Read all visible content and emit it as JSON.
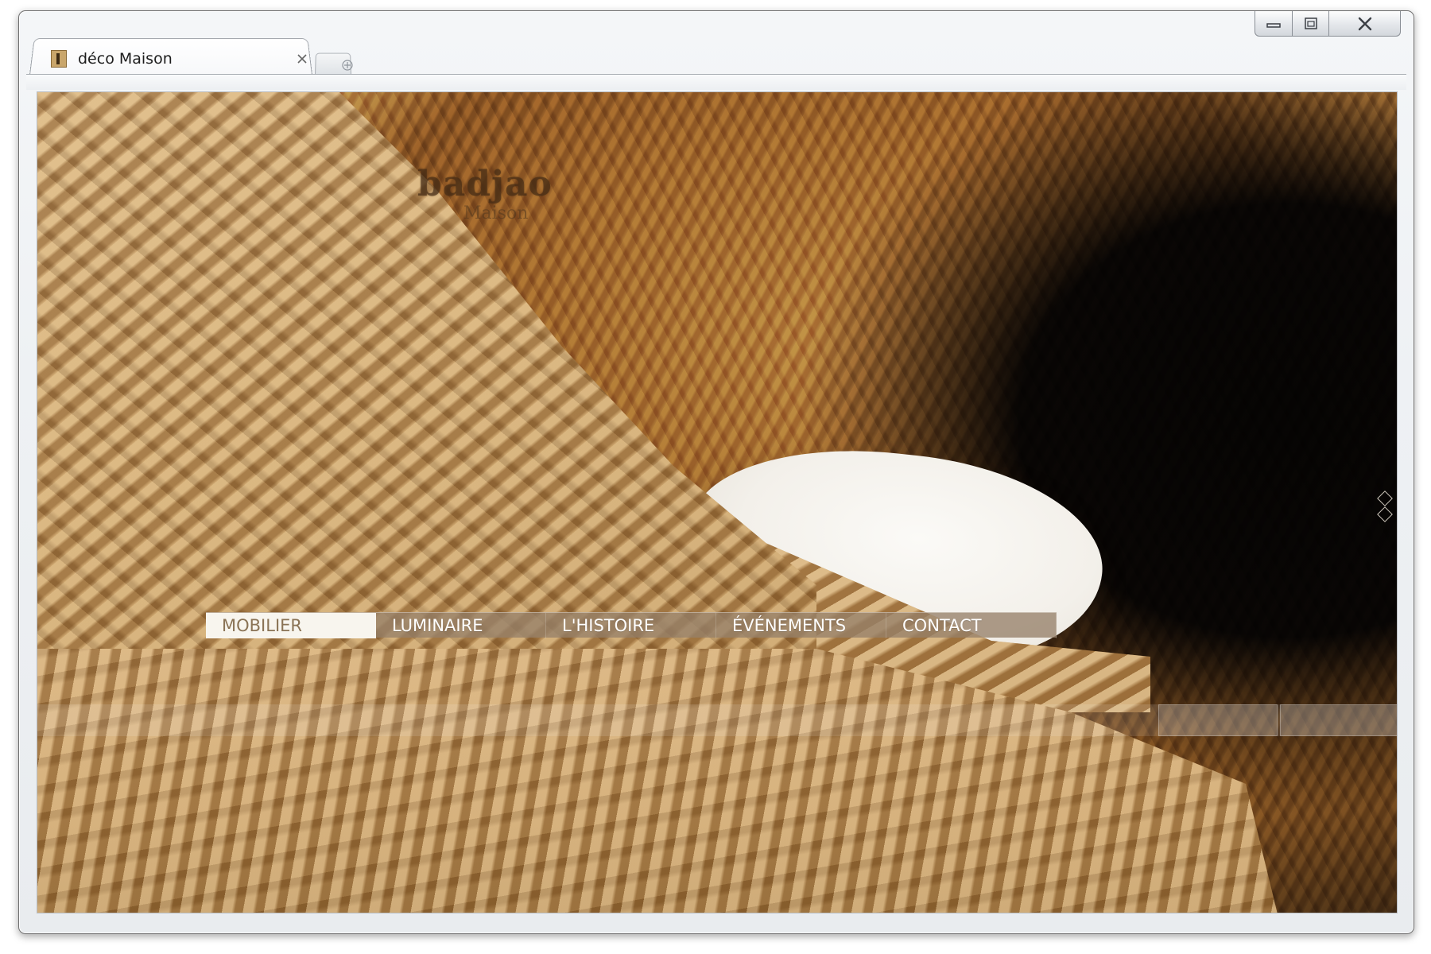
{
  "window": {
    "tab_title": "déco Maison",
    "controls": {
      "minimize": "minimize-icon",
      "maximize": "restore-icon",
      "close": "close-icon"
    }
  },
  "page": {
    "logo_main": "badjao",
    "logo_sub": "Maison",
    "nav": [
      {
        "label": "MOBILIER",
        "active": true
      },
      {
        "label": "LUMINAIRE",
        "active": false
      },
      {
        "label": "L'HISTOIRE",
        "active": false
      },
      {
        "label": "ÉVÉNEMENTS",
        "active": false
      },
      {
        "label": "CONTACT",
        "active": false
      }
    ],
    "slider_icons": [
      "diamond-up-icon",
      "diamond-down-icon"
    ]
  },
  "colors": {
    "nav_bg": "#96806a",
    "nav_active_bg": "#f8f5ee",
    "nav_active_text": "#8a7355",
    "nav_text": "#ffffff"
  }
}
